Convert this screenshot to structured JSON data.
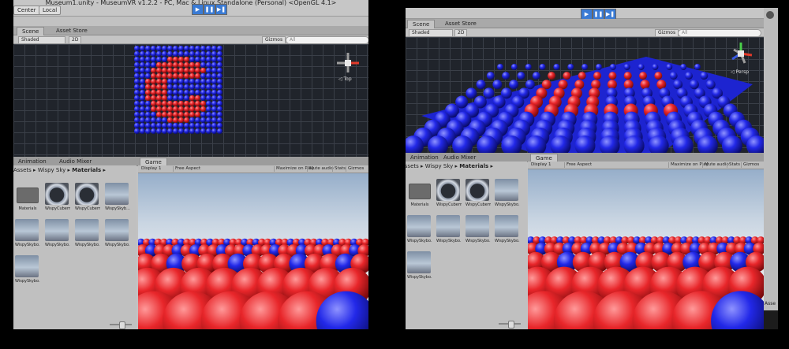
{
  "left": {
    "window_title": "Museum1.unity - MuseumVR v1.2.2 - PC, Mac & Linux Standalone (Personal) <OpenGL 4.1>",
    "toolbar": {
      "center_label": "Center",
      "local_label": "Local"
    },
    "scene_tabs": {
      "scene": "Scene",
      "asset_store": "Asset Store"
    },
    "scene_bar": {
      "shading": "Shaded",
      "mode": "2D",
      "gizmos": "Gizmos",
      "search_placeholder": "All"
    },
    "view_label": "Top",
    "bottom_tabs": {
      "animation": "Animation",
      "audio_mixer": "Audio Mixer",
      "game": "Game"
    },
    "breadcrumb": {
      "root": "Assets",
      "folder": "Wispy Sky",
      "current": "Materials"
    },
    "assets": [
      {
        "name": "Materials",
        "kind": "folder"
      },
      {
        "name": "WispyCubem...",
        "kind": "cube"
      },
      {
        "name": "WispyCubem...",
        "kind": "cube"
      },
      {
        "name": "WispySkyb...",
        "kind": "sky"
      },
      {
        "name": "WispySkybo...",
        "kind": "sky"
      },
      {
        "name": "WispySkybo...",
        "kind": "sky"
      },
      {
        "name": "WispySkybo...",
        "kind": "sky"
      },
      {
        "name": "WispySkybo...",
        "kind": "sky"
      },
      {
        "name": "WispySkybo...",
        "kind": "sky"
      }
    ],
    "game_bar": {
      "display": "Display 1",
      "aspect": "Free Aspect",
      "maximize": "Maximize on Play",
      "mute": "Mute audio",
      "stats": "Stats",
      "gizmos": "Gizmos"
    }
  },
  "right": {
    "scene_tabs": {
      "scene": "Scene",
      "asset_store": "Asset Store"
    },
    "scene_bar": {
      "shading": "Shaded",
      "mode": "2D",
      "gizmos": "Gizmos",
      "search_placeholder": "All"
    },
    "view_label": "Persp",
    "bottom_tabs": {
      "animation": "Animation",
      "audio_mixer": "Audio Mixer",
      "game": "Game"
    },
    "breadcrumb": {
      "root": "Assets",
      "folder": "Wispy Sky",
      "current": "Materials"
    },
    "assets": [
      {
        "name": "Materials",
        "kind": "folder"
      },
      {
        "name": "WispyCubem...",
        "kind": "cube"
      },
      {
        "name": "WispyCubem...",
        "kind": "cube"
      },
      {
        "name": "WispySkybo...",
        "kind": "sky"
      },
      {
        "name": "WispySkybo...",
        "kind": "sky"
      },
      {
        "name": "WispySkybo...",
        "kind": "sky"
      },
      {
        "name": "WispySkybo...",
        "kind": "sky"
      },
      {
        "name": "WispySkybo...",
        "kind": "sky"
      },
      {
        "name": "WispySkybo...",
        "kind": "sky"
      }
    ],
    "game_bar": {
      "display": "Display 1",
      "aspect": "Free Aspect",
      "maximize": "Maximize on Play",
      "mute": "Mute audio",
      "stats": "Stats",
      "gizmos": "Gizmos"
    },
    "side_panel_label": "Asse"
  },
  "colors": {
    "sphere_red": "#e8262a",
    "sphere_blue": "#2228e8",
    "scene_bg": "#20242b",
    "play_blue": "#3a7bd5"
  }
}
